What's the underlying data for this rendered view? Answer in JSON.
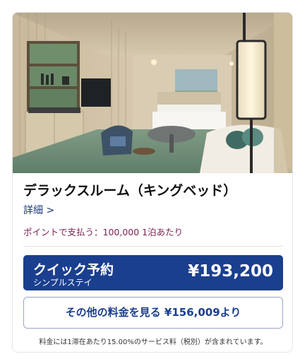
{
  "room": {
    "title": "デラックスルーム（キングベッド）",
    "details_link": "詳細 >",
    "points_text": "ポイントで支払う：100,000 1泊あたり"
  },
  "booking": {
    "quick_label": "クイック予約",
    "quick_sublabel": "シンプルステイ",
    "quick_price": "¥193,200",
    "other_rates_label": "その他の料金を見る ¥156,009より"
  },
  "note": "料金には1滞在あたり15.00%のサービス料（税別）が含まれています。",
  "colors": {
    "primary": "#1b3f8f",
    "points": "#7b1f4f",
    "link": "#1d3a7c"
  }
}
